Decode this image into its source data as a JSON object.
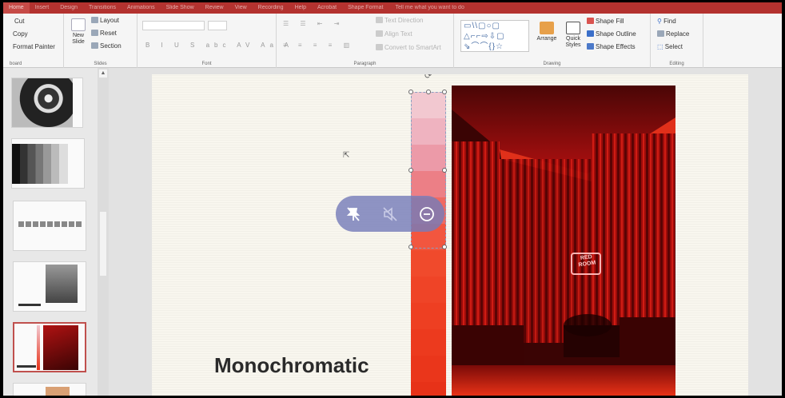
{
  "ribbon_tabs": [
    "Home",
    "Insert",
    "Design",
    "Transitions",
    "Animations",
    "Slide Show",
    "Review",
    "View",
    "Recording",
    "Help",
    "Acrobat",
    "Shape Format"
  ],
  "tell_me": "Tell me what you want to do",
  "clipboard": {
    "cut": "Cut",
    "copy": "Copy",
    "format_painter": "Format Painter",
    "label": "board"
  },
  "slides_group": {
    "new_slide": "New Slide",
    "layout": "Layout",
    "reset": "Reset",
    "section": "Section",
    "label": "Slides"
  },
  "font_group": {
    "label": "Font",
    "format_glyphs": "B I U S abc AV Aa A"
  },
  "paragraph_group": {
    "label": "Paragraph",
    "text_direction": "Text Direction",
    "align_text": "Align Text",
    "convert_smartart": "Convert to SmartArt"
  },
  "drawing_group": {
    "label": "Drawing",
    "arrange": "Arrange",
    "quick_styles": "Quick Styles",
    "shape_fill": "Shape Fill",
    "shape_outline": "Shape Outline",
    "shape_effects": "Shape Effects",
    "shapes_row1": "▭\\\\▢○▢",
    "shapes_row2": "△⌐⌐⇨⇩▢",
    "shapes_row3": "⇘⌒⌒{}☆"
  },
  "editing_group": {
    "label": "Editing",
    "find": "Find",
    "replace": "Replace",
    "select": "Select"
  },
  "slide": {
    "title": "Monochromatic"
  },
  "photo_sign": [
    "RED",
    "ROOM"
  ],
  "colors": {
    "ribbon_red": "#b3322f",
    "selected_thumb_border": "#c0504d",
    "strip": [
      "#f2c8d0",
      "#efb3c0",
      "#ec9aa8",
      "#ec7f86",
      "#ef6a62",
      "#f2563f",
      "#f04a2c",
      "#ef4427",
      "#ee3f22",
      "#ec3a1e",
      "#ea361b",
      "#e73218"
    ]
  },
  "icons": [
    "pin-off-icon",
    "mute-icon",
    "minus-circle-icon",
    "rotate-handle-icon",
    "cursor-icon"
  ]
}
